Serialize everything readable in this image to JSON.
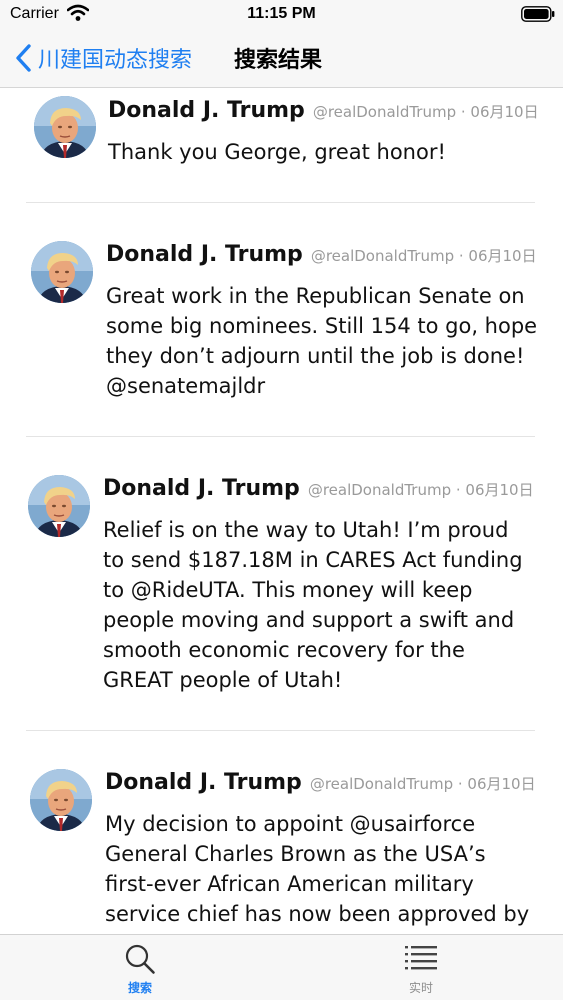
{
  "status_bar": {
    "carrier": "Carrier",
    "time": "11:15 PM"
  },
  "nav": {
    "back_label": "川建国动态搜索",
    "title": "搜索结果",
    "accent_color": "#1f7ff1"
  },
  "tweets": [
    {
      "author": "Donald J. Trump",
      "meta": "@realDonaldTrump · 06月10日",
      "text": "Thank you George, great honor!"
    },
    {
      "author": "Donald J. Trump",
      "meta": "@realDonaldTrump · 06月10日",
      "text": "Great work in the Republican Senate on some big nominees. Still 154 to go, hope they don’t adjourn until the job is done! @senatemajldr"
    },
    {
      "author": "Donald J. Trump",
      "meta": "@realDonaldTrump · 06月10日",
      "text": "Relief is on the way to Utah! I’m proud to send $187.18M in CARES Act funding to @RideUTA. This money will keep people moving and support a swift and smooth economic recovery for the GREAT people of Utah!"
    },
    {
      "author": "Donald J. Trump",
      "meta": "@realDonaldTrump · 06月10日",
      "text": "My decision to appoint @usairforce General Charles Brown as the USA’s first-ever African American military service chief has now been approved by the"
    }
  ],
  "tab_bar": {
    "tabs": [
      {
        "label": "搜索",
        "icon": "search-icon",
        "active": true
      },
      {
        "label": "实时",
        "icon": "list-icon",
        "active": false
      }
    ]
  }
}
